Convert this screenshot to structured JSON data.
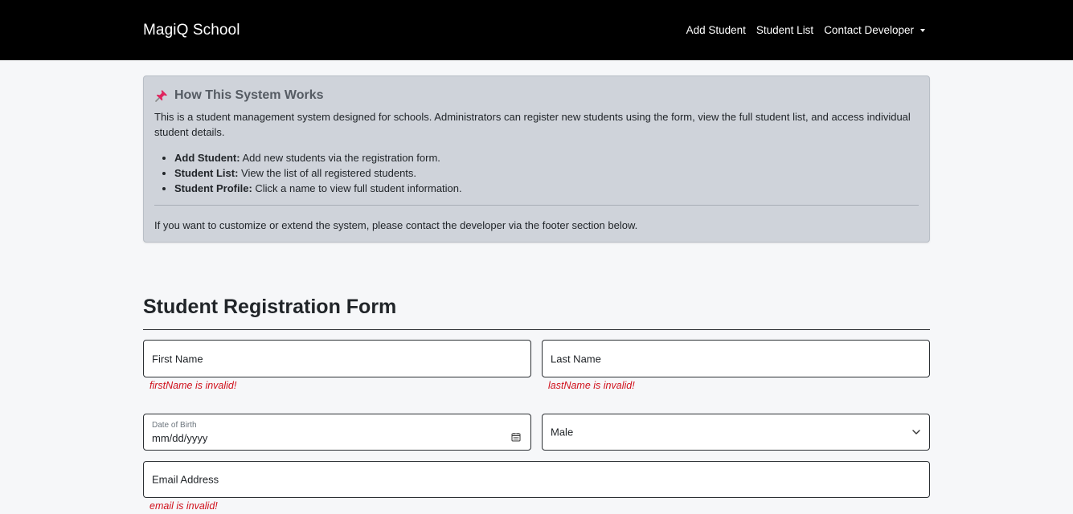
{
  "navbar": {
    "brand": "MagiQ School",
    "links": [
      "Add Student",
      "Student List"
    ],
    "dropdown": "Contact Developer"
  },
  "info": {
    "title": "How This System Works",
    "intro": "This is a student management system designed for schools. Administrators can register new students using the form, view the full student list, and access individual student details.",
    "items": [
      {
        "term": "Add Student:",
        "desc": " Add new students via the registration form."
      },
      {
        "term": "Student List:",
        "desc": " View the list of all registered students."
      },
      {
        "term": "Student Profile:",
        "desc": " Click a name to view full student information."
      }
    ],
    "footer": "If you want to customize or extend the system, please contact the developer via the footer section below."
  },
  "form": {
    "title": "Student Registration Form",
    "first_name": {
      "placeholder": "First Name",
      "error": "firstName is invalid!"
    },
    "last_name": {
      "placeholder": "Last Name",
      "error": "lastName is invalid!"
    },
    "dob": {
      "label": "Date of Birth",
      "value": "mm/dd/yyyy"
    },
    "gender": {
      "selected": "Male"
    },
    "email": {
      "placeholder": "Email Address",
      "error": "email is invalid!"
    }
  },
  "colors": {
    "navbar": "#000000",
    "info_card": "#cfd3da",
    "error": "#d0101b",
    "pin": "#e0245e"
  },
  "icons": {
    "pin": "pushpin-icon",
    "dropdown": "caret-down-icon",
    "calendar": "calendar-icon",
    "select": "chevron-down-icon"
  }
}
